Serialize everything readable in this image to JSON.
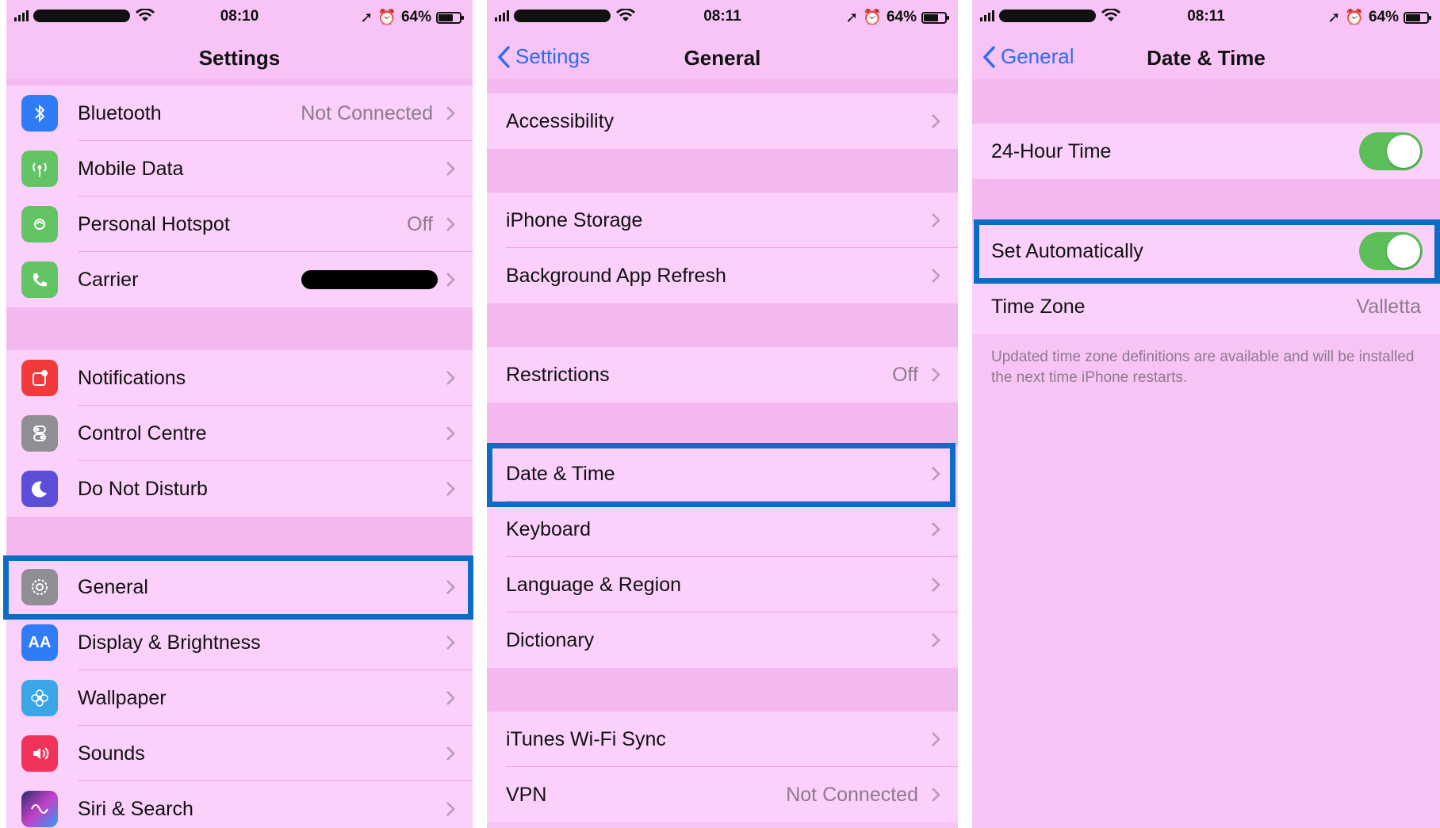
{
  "colors": {
    "background": "#f8c4f6",
    "highlight": "#0a6cc4",
    "link": "#2f6cf0",
    "toggle_on": "#5cbf5a",
    "secondary_text": "#8d7b8c"
  },
  "panel1": {
    "status": {
      "time": "08:10",
      "battery": "64%"
    },
    "title": "Settings",
    "group1": [
      {
        "label": "Bluetooth",
        "value": "Not Connected",
        "icon": "bluetooth-icon",
        "icon_color": "#2f7cf6"
      },
      {
        "label": "Mobile Data",
        "value": "",
        "icon": "antenna-icon",
        "icon_color": "#63c466"
      },
      {
        "label": "Personal Hotspot",
        "value": "Off",
        "icon": "hotspot-icon",
        "icon_color": "#63c466"
      },
      {
        "label": "Carrier",
        "value": "",
        "icon": "phone-icon",
        "icon_color": "#63c466"
      }
    ],
    "group2": [
      {
        "label": "Notifications",
        "icon": "notifications-icon",
        "icon_color": "#f13a3a"
      },
      {
        "label": "Control Centre",
        "icon": "switches-icon",
        "icon_color": "#8e8e93"
      },
      {
        "label": "Do Not Disturb",
        "icon": "moon-icon",
        "icon_color": "#5b4fd8"
      }
    ],
    "group3": [
      {
        "label": "General",
        "icon": "gear-icon",
        "icon_color": "#8e8e93"
      },
      {
        "label": "Display & Brightness",
        "icon": "text-size-icon",
        "icon_color": "#2f7cf6",
        "icon_text": "AA"
      },
      {
        "label": "Wallpaper",
        "icon": "flower-icon",
        "icon_color": "#3aa6e8"
      },
      {
        "label": "Sounds",
        "icon": "speaker-icon",
        "icon_color": "#f1335a"
      },
      {
        "label": "Siri & Search",
        "icon": "siri-icon",
        "icon_color": "#2b2b6b"
      }
    ]
  },
  "panel2": {
    "status": {
      "time": "08:11",
      "battery": "64%"
    },
    "back_label": "Settings",
    "title": "General",
    "group1": [
      {
        "label": "Accessibility",
        "value": ""
      }
    ],
    "group2": [
      {
        "label": "iPhone Storage",
        "value": ""
      },
      {
        "label": "Background App Refresh",
        "value": ""
      }
    ],
    "group3": [
      {
        "label": "Restrictions",
        "value": "Off"
      }
    ],
    "group4": [
      {
        "label": "Date & Time",
        "value": ""
      },
      {
        "label": "Keyboard",
        "value": ""
      },
      {
        "label": "Language & Region",
        "value": ""
      },
      {
        "label": "Dictionary",
        "value": ""
      }
    ],
    "group5": [
      {
        "label": "iTunes Wi-Fi Sync",
        "value": ""
      },
      {
        "label": "VPN",
        "value": "Not Connected"
      }
    ]
  },
  "panel3": {
    "status": {
      "time": "08:11",
      "battery": "64%"
    },
    "back_label": "General",
    "title": "Date & Time",
    "hour24": {
      "label": "24-Hour Time",
      "on": true
    },
    "set_auto": {
      "label": "Set Automatically",
      "on": true
    },
    "timezone": {
      "label": "Time Zone",
      "value": "Valletta"
    },
    "footnote": "Updated time zone definitions are available and will be installed the next time iPhone restarts."
  }
}
